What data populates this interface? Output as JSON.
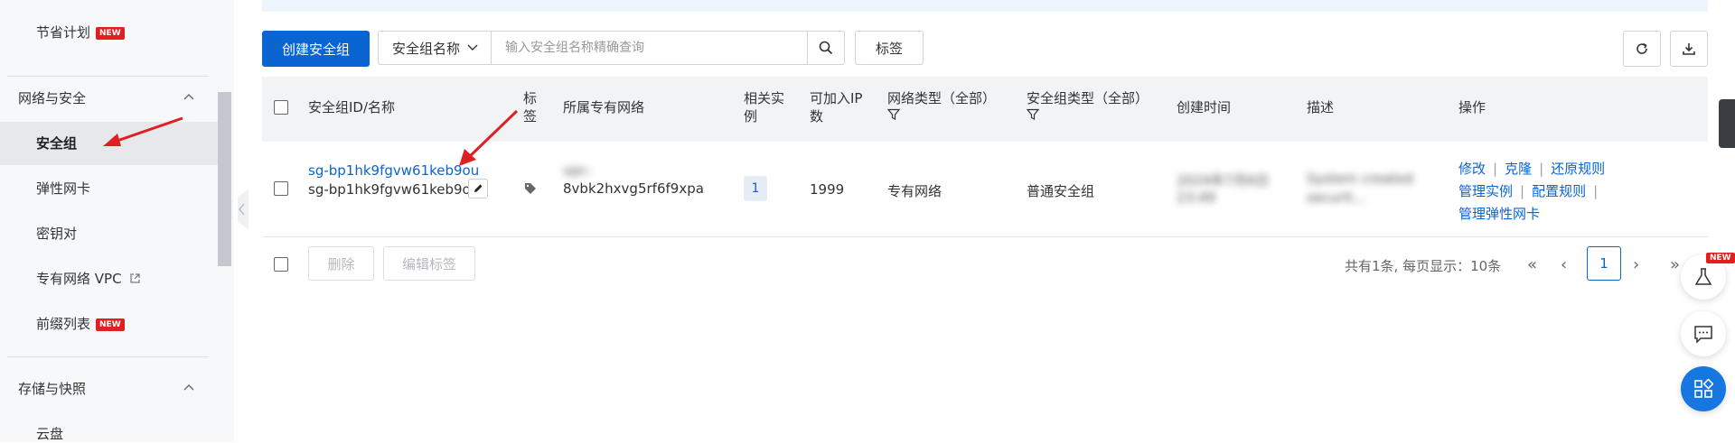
{
  "sidebar": {
    "items": [
      {
        "label": "节省计划",
        "badge": "NEW"
      },
      {
        "label": "网络与安全"
      },
      {
        "label": "安全组"
      },
      {
        "label": "弹性网卡"
      },
      {
        "label": "密钥对"
      },
      {
        "label": "专有网络 VPC"
      },
      {
        "label": "前缀列表",
        "badge": "NEW"
      },
      {
        "label": "存储与快照"
      },
      {
        "label": "云盘"
      }
    ]
  },
  "toolbar": {
    "create_label": "创建安全组",
    "filter_select": "安全组名称",
    "search_placeholder": "输入安全组名称精确查询",
    "tag_label": "标签"
  },
  "table": {
    "columns": [
      {
        "label": "安全组ID/名称"
      },
      {
        "label": "标签"
      },
      {
        "label": "所属专有网络"
      },
      {
        "label": "相关实例"
      },
      {
        "label": "可加入IP数"
      },
      {
        "label": "网络类型（全部）"
      },
      {
        "label": "安全组类型（全部）"
      },
      {
        "label": "创建时间"
      },
      {
        "label": "描述"
      },
      {
        "label": "操作"
      }
    ],
    "rows": [
      {
        "id": "sg-bp1hk9fgvw61keb9ou",
        "name": "sg-bp1hk9fgvw61keb9o...",
        "vpc_line1": "vpc-",
        "vpc_line2": "8vbk2hxvg5rf6f9xpa",
        "instances": "1",
        "ip_capacity": "1999",
        "network_type": "专有网络",
        "sg_type": "普通安全组",
        "created_1": "2024年7月6日",
        "created_2": "23:49",
        "desc_1": "System created",
        "desc_2": "securit...",
        "ops": [
          "修改",
          "克隆",
          "还原规则",
          "管理实例",
          "配置规则",
          "管理弹性网卡"
        ]
      }
    ]
  },
  "footer": {
    "delete_label": "删除",
    "edit_tag_label": "编辑标签",
    "pagination_info": "共有1条, 每页显示：10条",
    "first": "«",
    "prev": "‹",
    "current_page": "1",
    "next": "›",
    "last": "»"
  },
  "floating": {
    "new_badge": "NEW"
  },
  "colors": {
    "primary": "#0a64d2",
    "new_badge": "#e02020",
    "annotation_arrow": "#e02020"
  }
}
